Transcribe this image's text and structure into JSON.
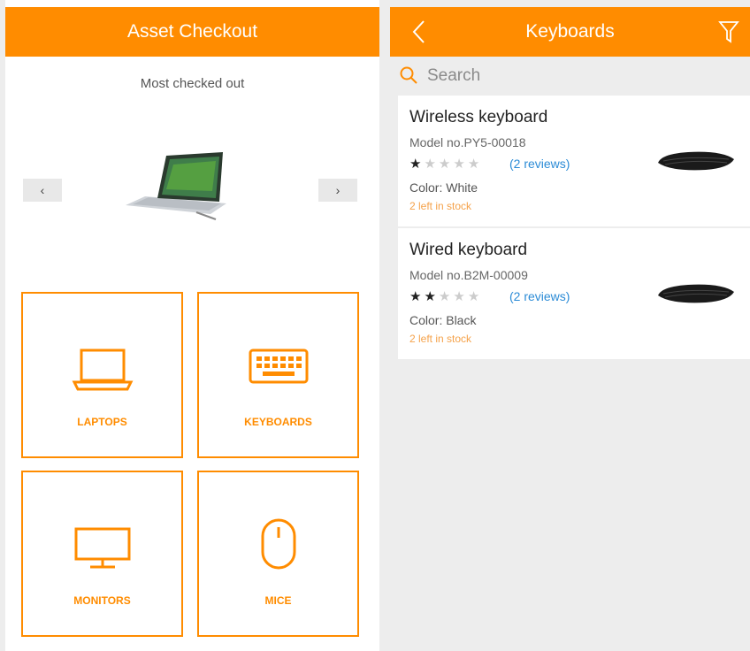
{
  "left_screen": {
    "header_title": "Asset Checkout",
    "most_checked_out": "Most checked out",
    "carousel": {
      "prev_label": "‹",
      "next_label": "›"
    },
    "categories": [
      {
        "label": "LAPTOPS",
        "icon": "laptop-icon"
      },
      {
        "label": "KEYBOARDS",
        "icon": "keyboard-icon"
      },
      {
        "label": "MONITORS",
        "icon": "monitor-icon"
      },
      {
        "label": "MICE",
        "icon": "mouse-icon"
      }
    ]
  },
  "right_screen": {
    "header_title": "Keyboards",
    "search_placeholder": "Search",
    "items": [
      {
        "name": "Wireless keyboard",
        "model": "Model no.PY5-00018",
        "rating": 1,
        "rating_max": 5,
        "reviews": "(2 reviews)",
        "color": "Color: White",
        "stock": "2 left in stock"
      },
      {
        "name": "Wired keyboard",
        "model": "Model no.B2M-00009",
        "rating": 2,
        "rating_max": 5,
        "reviews": "(2 reviews)",
        "color": "Color: Black",
        "stock": "2 left in stock"
      }
    ]
  },
  "colors": {
    "accent": "#ff8c00",
    "link": "#2b8bd6",
    "stock": "#f5a24a"
  }
}
